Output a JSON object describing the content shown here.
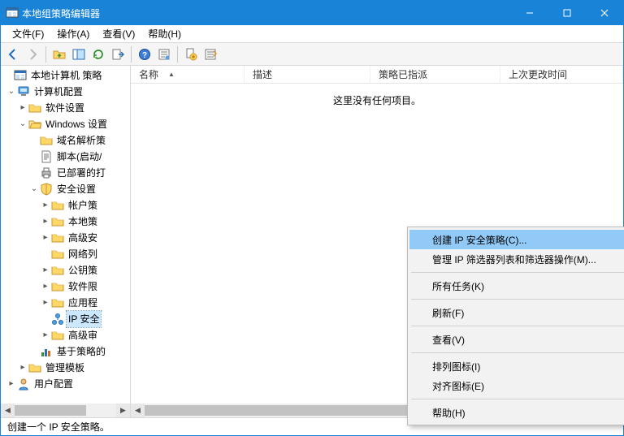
{
  "window": {
    "title": "本地组策略编辑器"
  },
  "menubar": {
    "file": "文件(F)",
    "action": "操作(A)",
    "view": "查看(V)",
    "help": "帮助(H)"
  },
  "tree": {
    "root": "本地计算机 策略",
    "computer_config": "计算机配置",
    "software_settings": "软件设置",
    "windows_settings": "Windows 设置",
    "dns_policy": "域名解析策",
    "scripts": "脚本(启动/",
    "deployed_printers": "已部署的打",
    "security_settings": "安全设置",
    "account_policies": "帐户策",
    "local_policies": "本地策",
    "advanced_security": "高级安",
    "network_list": "网络列",
    "public_key": "公钥策",
    "software_restriction": "软件限",
    "app_control": "应用程",
    "ip_security": "IP 安全",
    "advanced_audit": "高级审",
    "policy_based": "基于策略的",
    "admin_templates": "管理模板",
    "user_config": "用户配置"
  },
  "list": {
    "col_name": "名称",
    "col_desc": "描述",
    "col_assigned": "策略已指派",
    "col_modified": "上次更改时间",
    "empty_text": "这里没有任何项目。"
  },
  "context_menu": {
    "create_ip_policy": "创建 IP 安全策略(C)...",
    "manage_ip_filters": "管理 IP 筛选器列表和筛选器操作(M)...",
    "all_tasks": "所有任务(K)",
    "refresh": "刷新(F)",
    "view": "查看(V)",
    "arrange_icons": "排列图标(I)",
    "align_icons": "对齐图标(E)",
    "help": "帮助(H)"
  },
  "statusbar": {
    "text": "创建一个 IP 安全策略。"
  }
}
